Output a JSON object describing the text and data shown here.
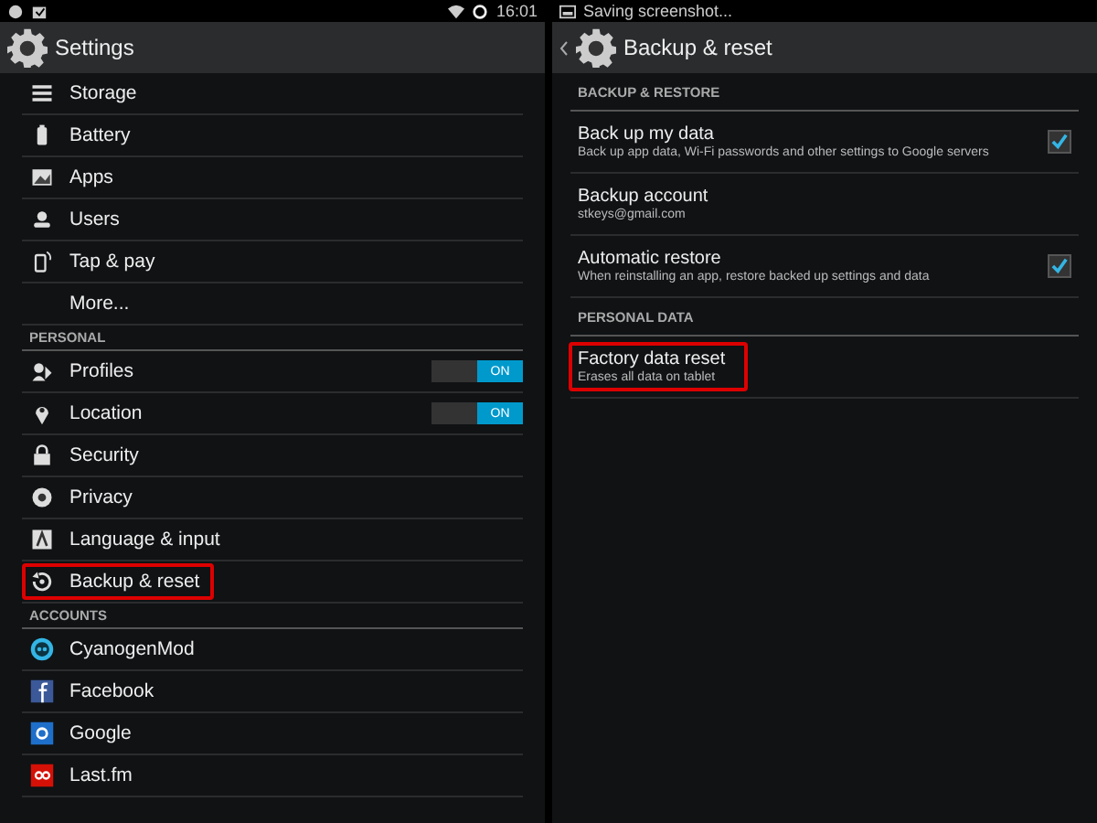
{
  "left": {
    "status_bar": {
      "time": "16:01"
    },
    "title": "Settings",
    "list": [
      {
        "kind": "item",
        "label": "Storage",
        "highlighted": false
      },
      {
        "kind": "item",
        "label": "Battery",
        "highlighted": false
      },
      {
        "kind": "item",
        "label": "Apps",
        "highlighted": false
      },
      {
        "kind": "item",
        "label": "Users",
        "highlighted": false
      },
      {
        "kind": "item",
        "label": "Tap & pay",
        "highlighted": false
      },
      {
        "kind": "item",
        "label": "More...",
        "highlighted": false
      },
      {
        "kind": "header",
        "label": "PERSONAL"
      },
      {
        "kind": "toggle",
        "label": "Profiles",
        "on": true,
        "state_label": "ON",
        "highlighted": false
      },
      {
        "kind": "toggle",
        "label": "Location",
        "on": true,
        "state_label": "ON",
        "highlighted": false
      },
      {
        "kind": "item",
        "label": "Security",
        "highlighted": false
      },
      {
        "kind": "item",
        "label": "Privacy",
        "highlighted": false
      },
      {
        "kind": "item",
        "label": "Language & input",
        "highlighted": false
      },
      {
        "kind": "item",
        "label": "Backup & reset",
        "highlighted": true
      },
      {
        "kind": "header",
        "label": "ACCOUNTS"
      },
      {
        "kind": "item",
        "label": "CyanogenMod",
        "highlighted": false
      },
      {
        "kind": "item",
        "label": "Facebook",
        "highlighted": false
      },
      {
        "kind": "item",
        "label": "Google",
        "highlighted": false
      },
      {
        "kind": "item",
        "label": "Last.fm",
        "highlighted": false
      }
    ]
  },
  "right": {
    "status_bar": {
      "notification": "Saving screenshot..."
    },
    "title": "Backup & reset",
    "list": [
      {
        "kind": "header",
        "label": "BACKUP & RESTORE"
      },
      {
        "kind": "check",
        "title": "Back up my data",
        "summary": "Back up app data, Wi-Fi passwords and other settings to Google servers",
        "checked": true,
        "highlighted": false
      },
      {
        "kind": "plain",
        "title": "Backup account",
        "summary": "stkeys@gmail.com",
        "highlighted": false
      },
      {
        "kind": "check",
        "title": "Automatic restore",
        "summary": "When reinstalling an app, restore backed up settings and data",
        "checked": true,
        "highlighted": false
      },
      {
        "kind": "header",
        "label": "PERSONAL DATA"
      },
      {
        "kind": "plain",
        "title": "Factory data reset",
        "summary": "Erases all data on tablet",
        "highlighted": true
      }
    ]
  }
}
